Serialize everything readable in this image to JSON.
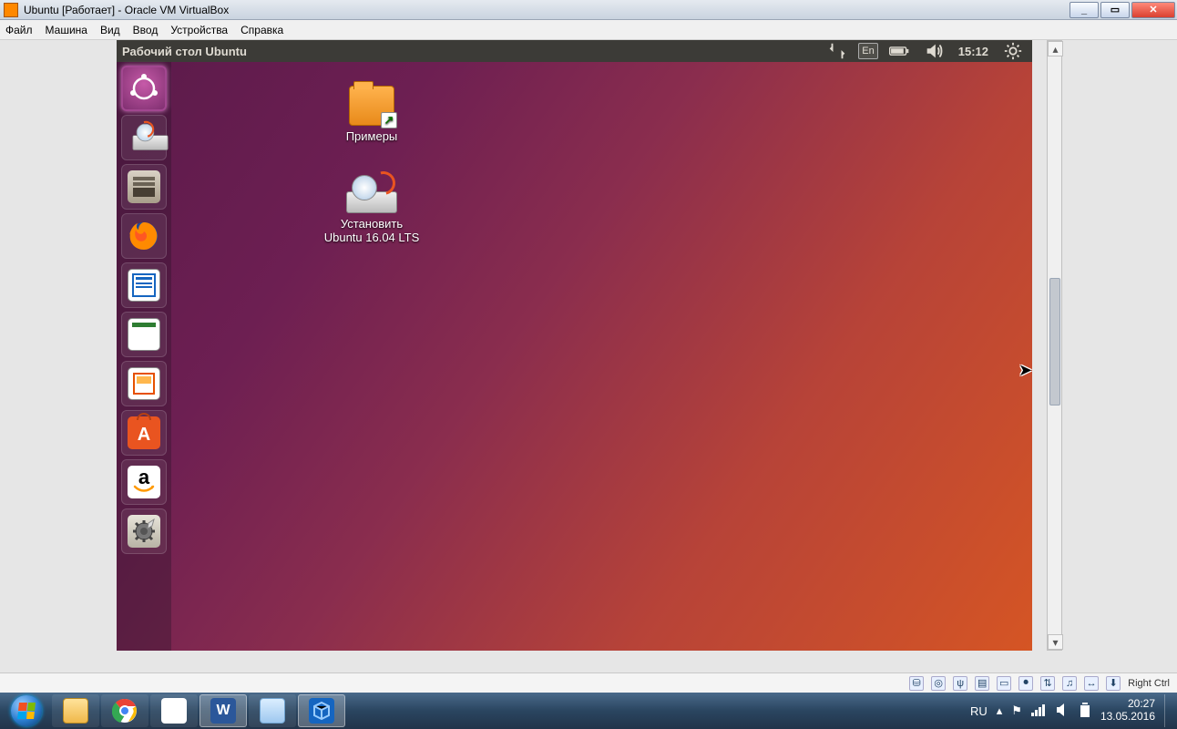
{
  "host_title": "Ubuntu [Работает] - Oracle VM VirtualBox",
  "vb_menu": {
    "file": "Файл",
    "machine": "Машина",
    "view": "Вид",
    "input": "Ввод",
    "devices": "Устройства",
    "help": "Справка"
  },
  "ubuntu": {
    "topbar_title": "Рабочий стол Ubuntu",
    "lang_indicator": "En",
    "clock": "15:12"
  },
  "desktop_icons": {
    "examples": "Примеры",
    "install_line1": "Установить",
    "install_line2": "Ubuntu 16.04 LTS"
  },
  "vb_status": {
    "hostkey": "Right Ctrl"
  },
  "host_tray": {
    "lang": "RU",
    "time": "20:27",
    "date": "13.05.2016"
  }
}
